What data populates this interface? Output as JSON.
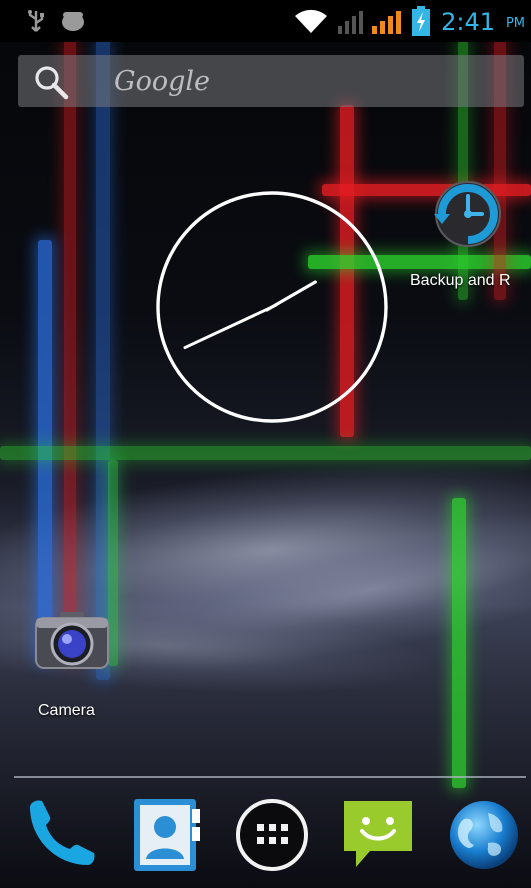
{
  "status_bar": {
    "time": "2:41",
    "ampm": "PM",
    "icons": [
      "usb-icon",
      "android-notification-icon",
      "wifi-icon",
      "signal-icon-1",
      "signal-icon-2",
      "battery-charging-icon"
    ]
  },
  "search": {
    "label": "Google",
    "icon": "search-icon"
  },
  "clock": {
    "hour_hand_angle_deg": 60,
    "minute_hand_angle_deg": 245
  },
  "home_apps": [
    {
      "id": "backup",
      "label": "Backup and R",
      "icon": "backup-clock-icon"
    },
    {
      "id": "camera",
      "label": "Camera",
      "icon": "camera-icon"
    }
  ],
  "dock": [
    {
      "id": "phone",
      "icon": "phone-icon"
    },
    {
      "id": "contacts",
      "icon": "contacts-icon"
    },
    {
      "id": "all-apps",
      "icon": "app-drawer-icon"
    },
    {
      "id": "messaging",
      "icon": "messaging-icon"
    },
    {
      "id": "browser",
      "icon": "browser-globe-icon"
    }
  ],
  "colors": {
    "accent": "#33b5e5",
    "neon_blue": "#2b6fe0",
    "neon_red": "#e31d22",
    "neon_green": "#2ed62e"
  }
}
